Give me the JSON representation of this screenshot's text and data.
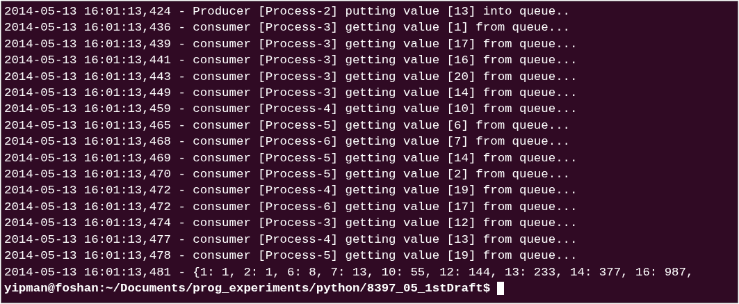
{
  "terminal": {
    "lines": [
      "2014-05-13 16:01:13,424 - Producer [Process-2] putting value [13] into queue..",
      "2014-05-13 16:01:13,436 - consumer [Process-3] getting value [1] from queue...",
      "2014-05-13 16:01:13,439 - consumer [Process-3] getting value [17] from queue...",
      "2014-05-13 16:01:13,441 - consumer [Process-3] getting value [16] from queue...",
      "2014-05-13 16:01:13,443 - consumer [Process-3] getting value [20] from queue...",
      "2014-05-13 16:01:13,449 - consumer [Process-3] getting value [14] from queue...",
      "2014-05-13 16:01:13,459 - consumer [Process-4] getting value [10] from queue...",
      "2014-05-13 16:01:13,465 - consumer [Process-5] getting value [6] from queue...",
      "2014-05-13 16:01:13,468 - consumer [Process-6] getting value [7] from queue...",
      "2014-05-13 16:01:13,469 - consumer [Process-5] getting value [14] from queue...",
      "2014-05-13 16:01:13,470 - consumer [Process-5] getting value [2] from queue...",
      "2014-05-13 16:01:13,472 - consumer [Process-4] getting value [19] from queue...",
      "2014-05-13 16:01:13,472 - consumer [Process-6] getting value [17] from queue...",
      "2014-05-13 16:01:13,474 - consumer [Process-3] getting value [12] from queue...",
      "2014-05-13 16:01:13,477 - consumer [Process-4] getting value [13] from queue...",
      "2014-05-13 16:01:13,478 - consumer [Process-5] getting value [19] from queue...",
      "2014-05-13 16:01:13,481 - {1: 1, 2: 1, 6: 8, 7: 13, 10: 55, 12: 144, 13: 233, 14: 377, 16: 987,"
    ],
    "prompt": "yipman@foshan:~/Documents/prog_experiments/python/8397_05_1stDraft$",
    "cursor_visible": true
  }
}
